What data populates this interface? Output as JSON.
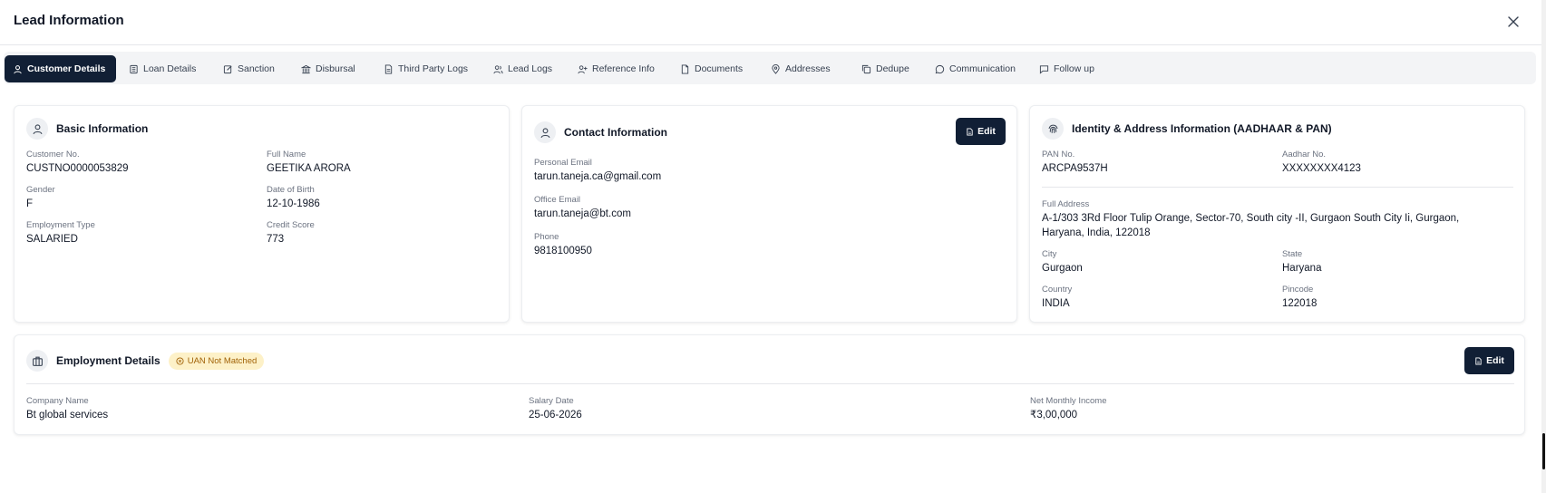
{
  "modal": {
    "title": "Lead Information"
  },
  "tabs": [
    {
      "label": "Customer Details",
      "icon": "user-icon"
    },
    {
      "label": "Loan Details",
      "icon": "bank-icon"
    },
    {
      "label": "Sanction",
      "icon": "pen-icon"
    },
    {
      "label": "Disbursal",
      "icon": "building-icon"
    },
    {
      "label": "Third Party Logs",
      "icon": "file-text-icon"
    },
    {
      "label": "Lead Logs",
      "icon": "users-icon"
    },
    {
      "label": "Reference Info",
      "icon": "user-plus-icon"
    },
    {
      "label": "Documents",
      "icon": "file-icon"
    },
    {
      "label": "Addresses",
      "icon": "map-pin-icon"
    },
    {
      "label": "Dedupe",
      "icon": "copy-icon"
    },
    {
      "label": "Communication",
      "icon": "chat-icon"
    },
    {
      "label": "Follow up",
      "icon": "message-square-icon"
    }
  ],
  "basic": {
    "title": "Basic Information",
    "customer_no_label": "Customer No.",
    "customer_no": "CUSTNO0000053829",
    "full_name_label": "Full Name",
    "full_name": "GEETIKA ARORA",
    "gender_label": "Gender",
    "gender": "F",
    "dob_label": "Date of Birth",
    "dob": "12-10-1986",
    "employment_type_label": "Employment Type",
    "employment_type": "SALARIED",
    "credit_score_label": "Credit Score",
    "credit_score": "773"
  },
  "contact": {
    "title": "Contact Information",
    "edit_label": "Edit",
    "personal_email_label": "Personal Email",
    "personal_email": "tarun.taneja.ca@gmail.com",
    "office_email_label": "Office Email",
    "office_email": "tarun.taneja@bt.com",
    "phone_label": "Phone",
    "phone": "9818100950"
  },
  "identity": {
    "title": "Identity & Address Information (AADHAAR & PAN)",
    "pan_label": "PAN No.",
    "pan": "ARCPA9537H",
    "aadhar_label": "Aadhar No.",
    "aadhar": "XXXXXXXX4123",
    "full_address_label": "Full Address",
    "full_address": "A-1/303 3Rd Floor Tulip Orange, Sector-70, South city -II, Gurgaon South City Ii, Gurgaon, Haryana, India, 122018",
    "city_label": "City",
    "city": "Gurgaon",
    "state_label": "State",
    "state": "Haryana",
    "country_label": "Country",
    "country": "INDIA",
    "pincode_label": "Pincode",
    "pincode": "122018"
  },
  "employment": {
    "title": "Employment Details",
    "badge": "UAN Not Matched",
    "edit_label": "Edit",
    "company_label": "Company Name",
    "company": "Bt global services",
    "salary_date_label": "Salary Date",
    "salary_date": "25-06-2026",
    "income_label": "Net Monthly Income",
    "income": "₹3,00,000"
  },
  "colors": {
    "primary": "#111f35",
    "badge_bg": "#fdf1c8",
    "badge_text": "#a16207"
  }
}
